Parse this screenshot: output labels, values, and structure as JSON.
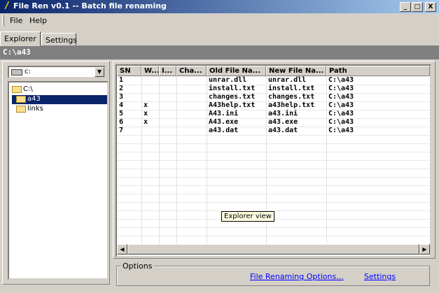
{
  "window": {
    "title": "File Ren v0.1 -- Batch file renaming",
    "min_btn": "_",
    "max_btn": "□",
    "close_btn": "X"
  },
  "menu": {
    "items": [
      {
        "label": "File"
      },
      {
        "label": "Help"
      }
    ]
  },
  "tabs": [
    {
      "label": "Explorer",
      "active": true
    },
    {
      "label": "Settings",
      "active": false
    }
  ],
  "path_bar": "C:\\a43",
  "drive_select": {
    "value": "c:",
    "icon": "drive-icon"
  },
  "tree": [
    {
      "label": "C:\\",
      "icon": "folder-open-icon",
      "selected": false
    },
    {
      "label": "a43",
      "icon": "folder-open-icon",
      "selected": true
    },
    {
      "label": "links",
      "icon": "folder-icon",
      "selected": false
    }
  ],
  "table": {
    "columns": [
      "SN",
      "W...",
      "I...",
      "Cha...",
      "Old File Na...",
      "New File Na...",
      "Path"
    ],
    "rows": [
      [
        "1",
        "",
        "",
        "",
        "unrar.dll",
        "unrar.dll",
        "C:\\a43"
      ],
      [
        "2",
        "",
        "",
        "",
        "install.txt",
        "install.txt",
        "C:\\a43"
      ],
      [
        "3",
        "",
        "",
        "",
        "changes.txt",
        "changes.txt",
        "C:\\a43"
      ],
      [
        "4",
        "x",
        "",
        "",
        "A43help.txt",
        "a43help.txt",
        "C:\\a43"
      ],
      [
        "5",
        "x",
        "",
        "",
        "A43.ini",
        "a43.ini",
        "C:\\a43"
      ],
      [
        "6",
        "x",
        "",
        "",
        "A43.exe",
        "a43.exe",
        "C:\\a43"
      ],
      [
        "7",
        "",
        "",
        "",
        "a43.dat",
        "a43.dat",
        "C:\\a43"
      ]
    ]
  },
  "tooltip": "Explorer view",
  "options": {
    "legend": "Options",
    "file_renaming_link": "File Renaming Options...",
    "settings_link": "Settings"
  },
  "colors": {
    "titlebar_start": "#0a246a",
    "titlebar_end": "#a6caf0",
    "face": "#d4d0c8",
    "path_bar": "#808080",
    "link": "#0000ff",
    "tooltip_bg": "#ffffe1"
  }
}
